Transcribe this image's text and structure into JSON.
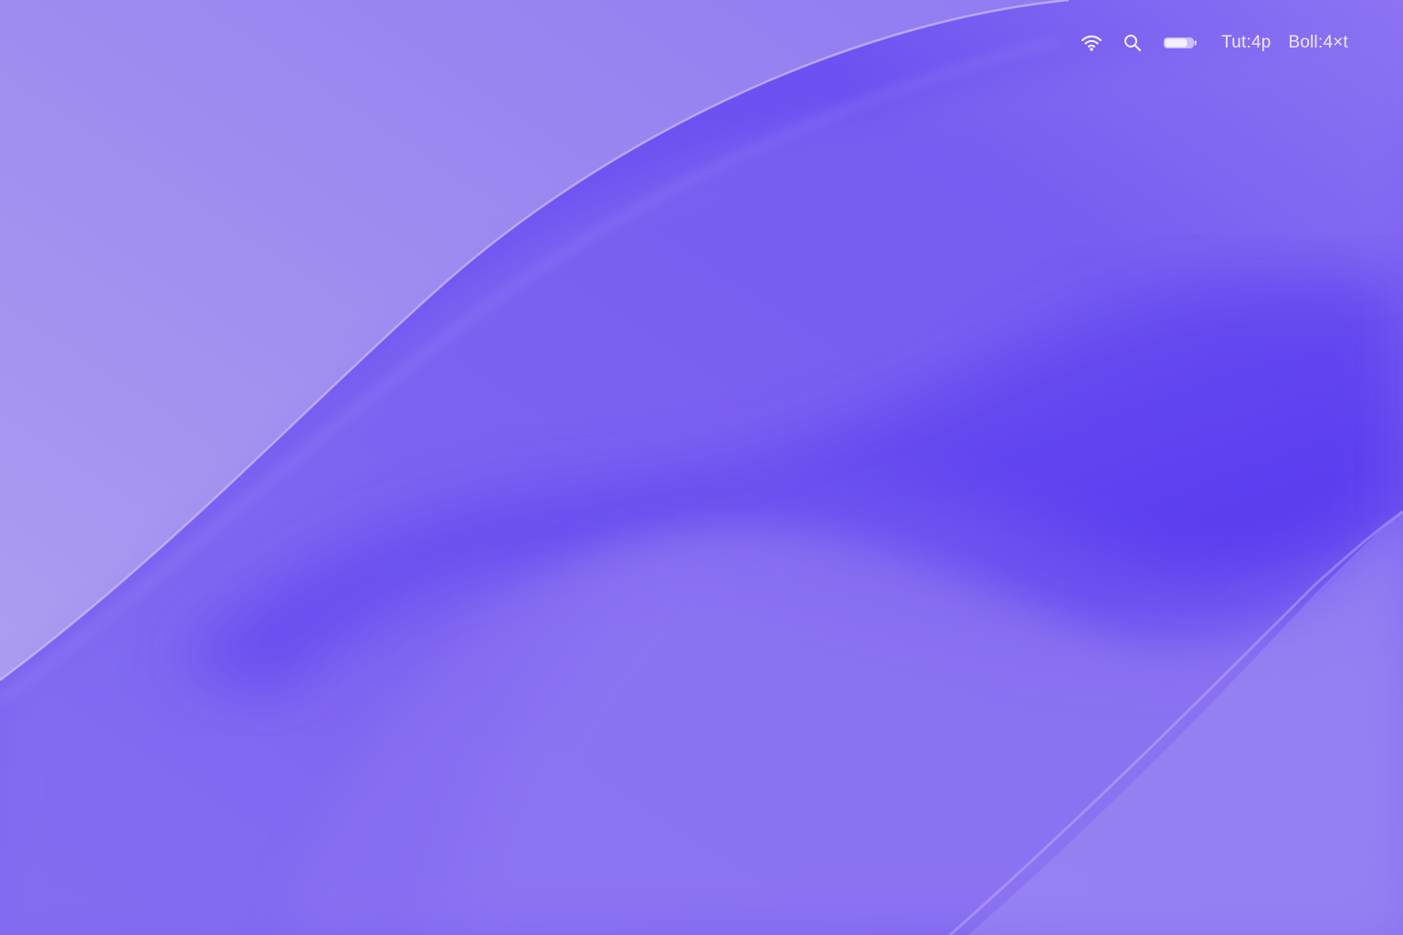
{
  "desktop": {
    "wallpaper": {
      "colors": {
        "base_light": "#a695ef",
        "mid": "#8d75f0",
        "deep": "#5b3df0",
        "highlight": "#b5a6f4"
      }
    }
  },
  "menubar": {
    "icons": {
      "wifi": "wifi-icon",
      "search": "search-icon",
      "battery": "battery-icon"
    },
    "items": [
      {
        "label": "Tut:4p"
      },
      {
        "label": "Boll:4×t"
      }
    ]
  }
}
